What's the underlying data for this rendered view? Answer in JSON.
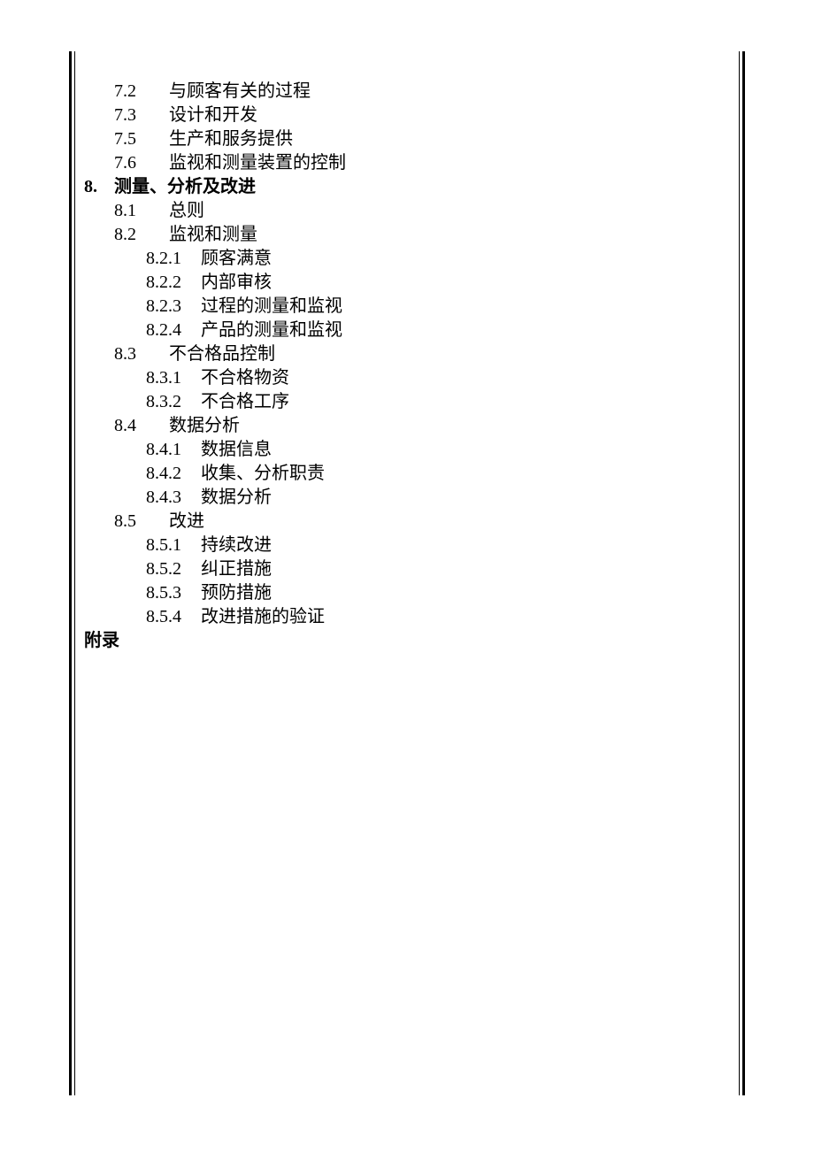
{
  "toc": {
    "section7": {
      "items": [
        {
          "num": "7.2",
          "title": "与顾客有关的过程"
        },
        {
          "num": "7.3",
          "title": "设计和开发"
        },
        {
          "num": "7.5",
          "title": "生产和服务提供"
        },
        {
          "num": "7.6",
          "title": "监视和测量装置的控制"
        }
      ]
    },
    "section8": {
      "num": "8.",
      "title": "测量、分析及改进",
      "items": [
        {
          "num": "8.1",
          "title": "总则"
        },
        {
          "num": "8.2",
          "title": "监视和测量",
          "sub": [
            {
              "num": "8.2.1",
              "title": "顾客满意"
            },
            {
              "num": "8.2.2",
              "title": "内部审核"
            },
            {
              "num": "8.2.3",
              "title": "过程的测量和监视"
            },
            {
              "num": "8.2.4",
              "title": "产品的测量和监视"
            }
          ]
        },
        {
          "num": "8.3",
          "title": "不合格品控制",
          "sub": [
            {
              "num": "8.3.1",
              "title": "不合格物资"
            },
            {
              "num": "8.3.2",
              "title": "不合格工序"
            }
          ]
        },
        {
          "num": "8.4",
          "title": "数据分析",
          "sub": [
            {
              "num": "8.4.1",
              "title": "数据信息"
            },
            {
              "num": "8.4.2",
              "title": "收集、分析职责"
            },
            {
              "num": "8.4.3",
              "title": "数据分析"
            }
          ]
        },
        {
          "num": "8.5",
          "title": "改进",
          "sub": [
            {
              "num": "8.5.1",
              "title": "持续改进"
            },
            {
              "num": "8.5.2",
              "title": "纠正措施"
            },
            {
              "num": "8.5.3",
              "title": "预防措施"
            },
            {
              "num": "8.5.4",
              "title": "改进措施的验证"
            }
          ]
        }
      ]
    },
    "appendix": "附录"
  }
}
